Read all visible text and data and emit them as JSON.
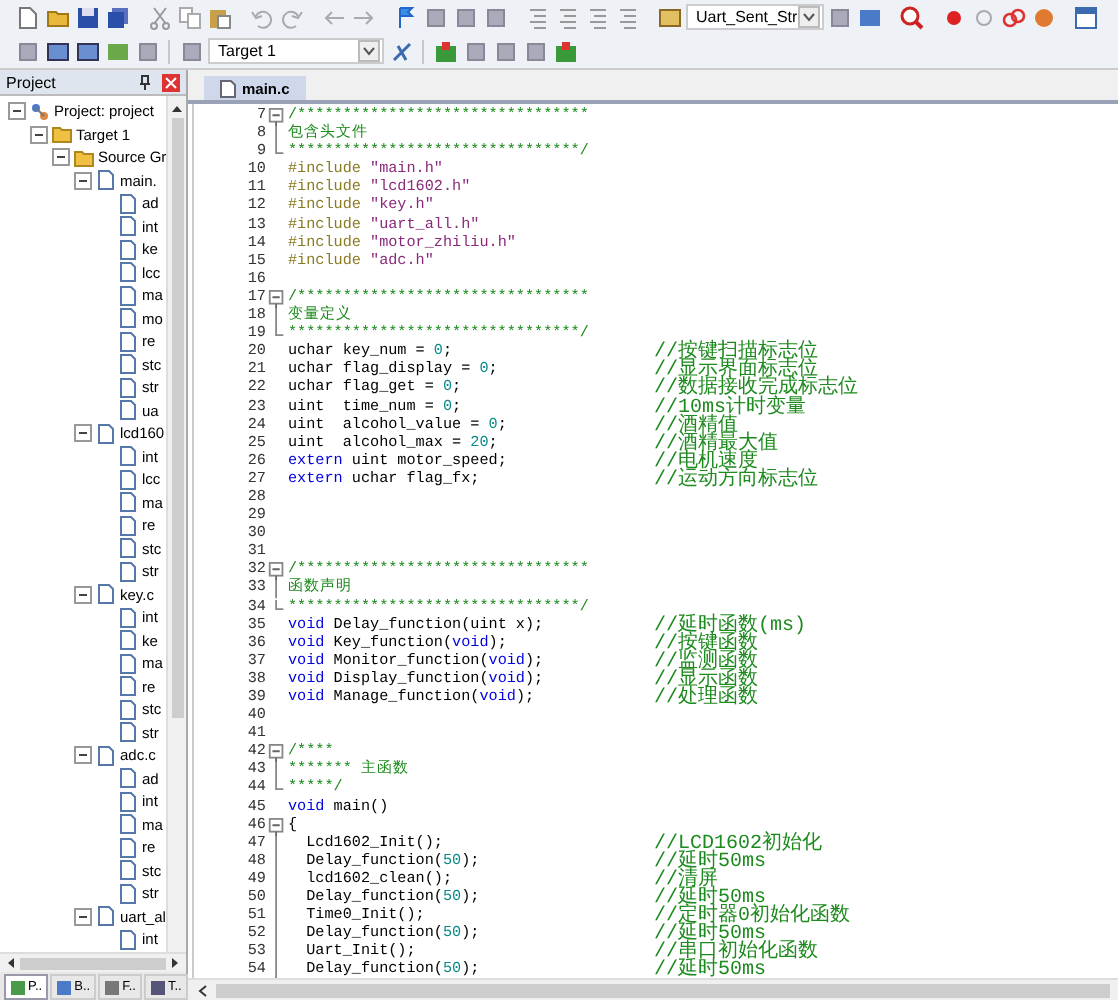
{
  "toolbar": {
    "function_dropdown": {
      "value": "Uart_Sent_Str"
    },
    "target_dropdown": {
      "value": "Target 1"
    }
  },
  "project_panel": {
    "title": "Project",
    "tree": [
      {
        "label": "Project: project",
        "kind": "project",
        "expanded": true,
        "children": [
          {
            "label": "Target 1",
            "kind": "target",
            "expanded": true,
            "children": [
              {
                "label": "Source Gr",
                "kind": "group",
                "expanded": true,
                "children": [
                  {
                    "label": "main.",
                    "kind": "source",
                    "expanded": true,
                    "children": [
                      {
                        "label": "ad",
                        "kind": "header"
                      },
                      {
                        "label": "int",
                        "kind": "header"
                      },
                      {
                        "label": "ke",
                        "kind": "header"
                      },
                      {
                        "label": "lcc",
                        "kind": "header"
                      },
                      {
                        "label": "ma",
                        "kind": "header"
                      },
                      {
                        "label": "mo",
                        "kind": "header"
                      },
                      {
                        "label": "re",
                        "kind": "header"
                      },
                      {
                        "label": "stc",
                        "kind": "header"
                      },
                      {
                        "label": "str",
                        "kind": "header"
                      },
                      {
                        "label": "ua",
                        "kind": "header"
                      }
                    ]
                  },
                  {
                    "label": "lcd160",
                    "kind": "source",
                    "expanded": true,
                    "children": [
                      {
                        "label": "int",
                        "kind": "header"
                      },
                      {
                        "label": "lcc",
                        "kind": "header"
                      },
                      {
                        "label": "ma",
                        "kind": "header"
                      },
                      {
                        "label": "re",
                        "kind": "header"
                      },
                      {
                        "label": "stc",
                        "kind": "header"
                      },
                      {
                        "label": "str",
                        "kind": "header"
                      }
                    ]
                  },
                  {
                    "label": "key.c",
                    "kind": "source",
                    "expanded": true,
                    "children": [
                      {
                        "label": "int",
                        "kind": "header"
                      },
                      {
                        "label": "ke",
                        "kind": "header"
                      },
                      {
                        "label": "ma",
                        "kind": "header"
                      },
                      {
                        "label": "re",
                        "kind": "header"
                      },
                      {
                        "label": "stc",
                        "kind": "header"
                      },
                      {
                        "label": "str",
                        "kind": "header"
                      }
                    ]
                  },
                  {
                    "label": "adc.c",
                    "kind": "source",
                    "expanded": true,
                    "children": [
                      {
                        "label": "ad",
                        "kind": "header"
                      },
                      {
                        "label": "int",
                        "kind": "header"
                      },
                      {
                        "label": "ma",
                        "kind": "header"
                      },
                      {
                        "label": "re",
                        "kind": "header"
                      },
                      {
                        "label": "stc",
                        "kind": "header"
                      },
                      {
                        "label": "str",
                        "kind": "header"
                      }
                    ]
                  },
                  {
                    "label": "uart_al",
                    "kind": "source",
                    "expanded": true,
                    "children": [
                      {
                        "label": "int",
                        "kind": "header"
                      }
                    ]
                  }
                ]
              }
            ]
          }
        ]
      }
    ],
    "tabs": [
      {
        "label": "P..",
        "selected": true
      },
      {
        "label": "B..",
        "selected": false
      },
      {
        "label": "F..",
        "selected": false
      },
      {
        "label": "T..",
        "selected": false
      }
    ]
  },
  "editor": {
    "tabs": [
      {
        "label": "main.c",
        "selected": true
      }
    ],
    "lines": [
      {
        "number": "7",
        "kind": "fold_start",
        "parts": [
          {
            "kind": "comment",
            "text": "/********************************"
          }
        ]
      },
      {
        "number": "8",
        "kind": "fold_mid",
        "parts": [
          {
            "kind": "comment",
            "text": "包含头文件"
          }
        ]
      },
      {
        "number": "9",
        "kind": "fold_end",
        "parts": [
          {
            "kind": "comment",
            "text": "********************************/"
          }
        ]
      },
      {
        "number": "10",
        "kind": "plain",
        "parts": [
          {
            "kind": "directive",
            "text": "#include "
          },
          {
            "kind": "string",
            "text": "\"main.h\""
          }
        ]
      },
      {
        "number": "11",
        "kind": "plain",
        "parts": [
          {
            "kind": "directive",
            "text": "#include "
          },
          {
            "kind": "string",
            "text": "\"lcd1602.h\""
          }
        ]
      },
      {
        "number": "12",
        "kind": "plain",
        "parts": [
          {
            "kind": "directive",
            "text": "#include "
          },
          {
            "kind": "string",
            "text": "\"key.h\""
          }
        ]
      },
      {
        "number": "13",
        "kind": "plain",
        "parts": [
          {
            "kind": "directive",
            "text": "#include "
          },
          {
            "kind": "string",
            "text": "\"uart_all.h\""
          }
        ]
      },
      {
        "number": "14",
        "kind": "plain",
        "parts": [
          {
            "kind": "directive",
            "text": "#include "
          },
          {
            "kind": "string",
            "text": "\"motor_zhiliu.h\""
          }
        ]
      },
      {
        "number": "15",
        "kind": "plain",
        "parts": [
          {
            "kind": "directive",
            "text": "#include "
          },
          {
            "kind": "string",
            "text": "\"adc.h\""
          }
        ]
      },
      {
        "number": "16",
        "kind": "plain"
      },
      {
        "number": "17",
        "kind": "fold_start",
        "parts": [
          {
            "kind": "comment",
            "text": "/********************************"
          }
        ]
      },
      {
        "number": "18",
        "kind": "fold_mid",
        "parts": [
          {
            "kind": "comment",
            "text": "变量定义"
          }
        ]
      },
      {
        "number": "19",
        "kind": "fold_end",
        "parts": [
          {
            "kind": "comment",
            "text": "********************************/"
          }
        ]
      },
      {
        "number": "20",
        "kind": "plain",
        "parts": [
          {
            "kind": "code",
            "text": "uchar key_num = "
          },
          {
            "kind": "number",
            "text": "0"
          },
          {
            "kind": "code",
            "text": ";"
          }
        ],
        "comment": "//按键扫描标志位"
      },
      {
        "number": "21",
        "kind": "plain",
        "parts": [
          {
            "kind": "code",
            "text": "uchar flag_display = "
          },
          {
            "kind": "number",
            "text": "0"
          },
          {
            "kind": "code",
            "text": ";"
          }
        ],
        "comment": "//显示界面标志位"
      },
      {
        "number": "22",
        "kind": "plain",
        "parts": [
          {
            "kind": "code",
            "text": "uchar flag_get = "
          },
          {
            "kind": "number",
            "text": "0"
          },
          {
            "kind": "code",
            "text": ";"
          }
        ],
        "comment": "//数据接收完成标志位"
      },
      {
        "number": "23",
        "kind": "plain",
        "parts": [
          {
            "kind": "code",
            "text": "uint  time_num = "
          },
          {
            "kind": "number",
            "text": "0"
          },
          {
            "kind": "code",
            "text": ";"
          }
        ],
        "comment": "//10ms计时变量"
      },
      {
        "number": "24",
        "kind": "plain",
        "parts": [
          {
            "kind": "code",
            "text": "uint  alcohol_value = "
          },
          {
            "kind": "number",
            "text": "0"
          },
          {
            "kind": "code",
            "text": ";"
          }
        ],
        "comment": "//酒精值"
      },
      {
        "number": "25",
        "kind": "plain",
        "parts": [
          {
            "kind": "code",
            "text": "uint  alcohol_max = "
          },
          {
            "kind": "number",
            "text": "20"
          },
          {
            "kind": "code",
            "text": ";"
          }
        ],
        "comment": "//酒精最大值"
      },
      {
        "number": "26",
        "kind": "plain",
        "parts": [
          {
            "kind": "keyword",
            "text": "extern"
          },
          {
            "kind": "code",
            "text": " uint motor_speed;"
          }
        ],
        "comment": "//电机速度"
      },
      {
        "number": "27",
        "kind": "plain",
        "parts": [
          {
            "kind": "keyword",
            "text": "extern"
          },
          {
            "kind": "code",
            "text": " uchar flag_fx;"
          }
        ],
        "comment": "//运动方向标志位"
      },
      {
        "number": "28",
        "kind": "plain"
      },
      {
        "number": "29",
        "kind": "plain"
      },
      {
        "number": "30",
        "kind": "plain"
      },
      {
        "number": "31",
        "kind": "plain"
      },
      {
        "number": "32",
        "kind": "fold_start",
        "parts": [
          {
            "kind": "comment",
            "text": "/********************************"
          }
        ]
      },
      {
        "number": "33",
        "kind": "fold_mid",
        "parts": [
          {
            "kind": "comment",
            "text": "函数声明"
          }
        ]
      },
      {
        "number": "34",
        "kind": "fold_end",
        "parts": [
          {
            "kind": "comment",
            "text": "********************************/"
          }
        ]
      },
      {
        "number": "35",
        "kind": "plain",
        "parts": [
          {
            "kind": "keyword",
            "text": "void"
          },
          {
            "kind": "code",
            "text": " Delay_function(uint x);"
          }
        ],
        "comment": "//延时函数(ms)"
      },
      {
        "number": "36",
        "kind": "plain",
        "parts": [
          {
            "kind": "keyword",
            "text": "void"
          },
          {
            "kind": "code",
            "text": " Key_function("
          },
          {
            "kind": "keyword",
            "text": "void"
          },
          {
            "kind": "code",
            "text": ");"
          }
        ],
        "comment": "//按键函数"
      },
      {
        "number": "37",
        "kind": "plain",
        "parts": [
          {
            "kind": "keyword",
            "text": "void"
          },
          {
            "kind": "code",
            "text": " Monitor_function("
          },
          {
            "kind": "keyword",
            "text": "void"
          },
          {
            "kind": "code",
            "text": ");"
          }
        ],
        "comment": "//监测函数"
      },
      {
        "number": "38",
        "kind": "plain",
        "parts": [
          {
            "kind": "keyword",
            "text": "void"
          },
          {
            "kind": "code",
            "text": " Display_function("
          },
          {
            "kind": "keyword",
            "text": "void"
          },
          {
            "kind": "code",
            "text": ");"
          }
        ],
        "comment": "//显示函数"
      },
      {
        "number": "39",
        "kind": "plain",
        "parts": [
          {
            "kind": "keyword",
            "text": "void"
          },
          {
            "kind": "code",
            "text": " Manage_function("
          },
          {
            "kind": "keyword",
            "text": "void"
          },
          {
            "kind": "code",
            "text": ");"
          }
        ],
        "comment": "//处理函数"
      },
      {
        "number": "40",
        "kind": "plain"
      },
      {
        "number": "41",
        "kind": "plain"
      },
      {
        "number": "42",
        "kind": "fold_start",
        "parts": [
          {
            "kind": "comment",
            "text": "/****"
          }
        ]
      },
      {
        "number": "43",
        "kind": "fold_mid",
        "parts": [
          {
            "kind": "comment",
            "text": "******* 主函数"
          }
        ]
      },
      {
        "number": "44",
        "kind": "fold_end",
        "parts": [
          {
            "kind": "comment",
            "text": "*****/"
          }
        ]
      },
      {
        "number": "45",
        "kind": "plain",
        "parts": [
          {
            "kind": "keyword",
            "text": "void"
          },
          {
            "kind": "code",
            "text": " main()"
          }
        ]
      },
      {
        "number": "46",
        "kind": "fold_start",
        "parts": [
          {
            "kind": "code",
            "text": "{"
          }
        ]
      },
      {
        "number": "47",
        "kind": "fold_mid",
        "parts": [
          {
            "kind": "code",
            "text": "  Lcd1602_Init();"
          }
        ],
        "comment": "//LCD1602初始化"
      },
      {
        "number": "48",
        "kind": "fold_mid",
        "parts": [
          {
            "kind": "code",
            "text": "  Delay_function("
          },
          {
            "kind": "number",
            "text": "50"
          },
          {
            "kind": "code",
            "text": ");"
          }
        ],
        "comment": "//延时50ms"
      },
      {
        "number": "49",
        "kind": "fold_mid",
        "parts": [
          {
            "kind": "code",
            "text": "  lcd1602_clean();"
          }
        ],
        "comment": "//清屏"
      },
      {
        "number": "50",
        "kind": "fold_mid",
        "parts": [
          {
            "kind": "code",
            "text": "  Delay_function("
          },
          {
            "kind": "number",
            "text": "50"
          },
          {
            "kind": "code",
            "text": ");"
          }
        ],
        "comment": "//延时50ms"
      },
      {
        "number": "51",
        "kind": "fold_mid",
        "parts": [
          {
            "kind": "code",
            "text": "  Time0_Init();"
          }
        ],
        "comment": "//定时器0初始化函数"
      },
      {
        "number": "52",
        "kind": "fold_mid",
        "parts": [
          {
            "kind": "code",
            "text": "  Delay_function("
          },
          {
            "kind": "number",
            "text": "50"
          },
          {
            "kind": "code",
            "text": ");"
          }
        ],
        "comment": "//延时50ms"
      },
      {
        "number": "53",
        "kind": "fold_mid",
        "parts": [
          {
            "kind": "code",
            "text": "  Uart_Init();"
          }
        ],
        "comment": "//串口初始化函数"
      },
      {
        "number": "54",
        "kind": "fold_mid",
        "parts": [
          {
            "kind": "code",
            "text": "  Delay_function("
          },
          {
            "kind": "number",
            "text": "50"
          },
          {
            "kind": "code",
            "text": ");"
          }
        ],
        "comment": "//延时50ms"
      }
    ]
  }
}
